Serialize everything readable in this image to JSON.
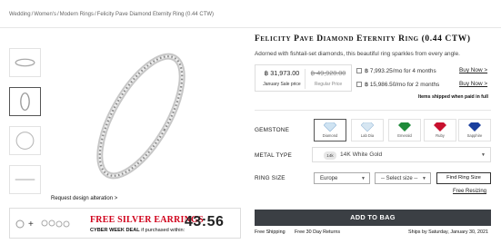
{
  "breadcrumb": [
    "Wedding",
    "Women's",
    "Modern Rings",
    "Felicity Pave Diamond Eternity Ring (0.44 CTW)"
  ],
  "gallery": {
    "request_link": "Request design alteration >"
  },
  "promo": {
    "title": "FREE SILVER EARRINGS",
    "subtitle_bold": "CYBER WEEK DEAL",
    "subtitle_rest": "if purchased within:",
    "timer": "43:56"
  },
  "product": {
    "title": "Felicity Pave Diamond Eternity Ring (0.44 CTW)",
    "description": "Adorned with fishtail-set diamonds, this beautiful ring sparkles from every angle."
  },
  "pricing": {
    "sale_price": "฿ 31,973.00",
    "sale_label": "January Sale price",
    "regular_price": "฿ 49,928.00",
    "regular_label": "Regular Price",
    "installments": [
      {
        "text": "฿ 7,993.25/mo for 4 months",
        "action": "Buy Now >"
      },
      {
        "text": "฿ 15,986.50/mo for 2 months",
        "action": "Buy Now >"
      }
    ],
    "ship_note": "Items shipped when paid in full"
  },
  "options": {
    "gemstone_label": "GEMSTONE",
    "gemstones": [
      {
        "name": "Diamond",
        "color": "#cfe3f2"
      },
      {
        "name": "Lab Dia",
        "color": "#d6e6f2"
      },
      {
        "name": "Emerald",
        "color": "#1f8a3a"
      },
      {
        "name": "Ruby",
        "color": "#c8102e"
      },
      {
        "name": "Sapphire",
        "color": "#1a3f9e"
      }
    ],
    "metal_label": "METAL TYPE",
    "metal_badge": "14k",
    "metal_value": "14K White Gold",
    "ring_size_label": "RING SIZE",
    "region_value": "Europe",
    "size_placeholder": "-- Select size --",
    "find_size": "Find Ring Size",
    "free_resizing": "Free Resizing"
  },
  "cart": {
    "add_to_bag": "ADD TO BAG",
    "free_shipping": "Free Shipping",
    "free_returns": "Free 30 Day Returns",
    "ships_by": "Ships by Saturday, January 30, 2021"
  },
  "colors": {
    "button_bg": "#3b3f44",
    "promo_red": "#d0021b"
  }
}
